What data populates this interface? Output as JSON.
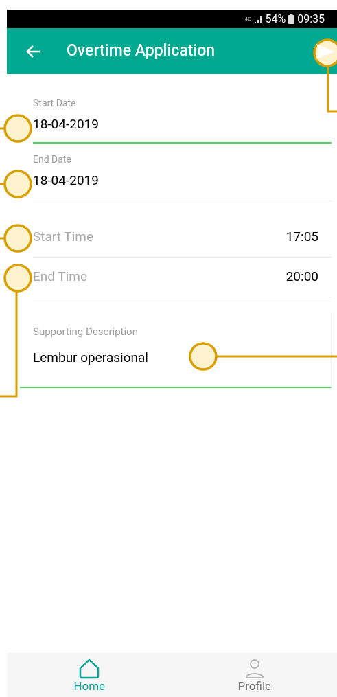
{
  "status_bar": {
    "network": "4G",
    "battery": "54%",
    "time": "09:35"
  },
  "app_bar": {
    "title": "Overtime Application"
  },
  "form": {
    "fields": [
      {
        "kind": "date",
        "label": "Start Date",
        "value": "18-04-2019",
        "focused": true
      },
      {
        "kind": "date",
        "label": "End Date",
        "value": "18-04-2019",
        "focused": false
      },
      {
        "kind": "time",
        "label": "Start Time",
        "value": "17:05",
        "focused": false
      },
      {
        "kind": "time",
        "label": "End Time",
        "value": "20:00",
        "focused": false
      },
      {
        "kind": "textarea",
        "label": "Supporting Description",
        "value": "Lembur operasional",
        "focused": true
      }
    ]
  },
  "bottom_nav": [
    {
      "label": "Home",
      "selected": true
    },
    {
      "label": "Profile",
      "selected": false
    }
  ]
}
